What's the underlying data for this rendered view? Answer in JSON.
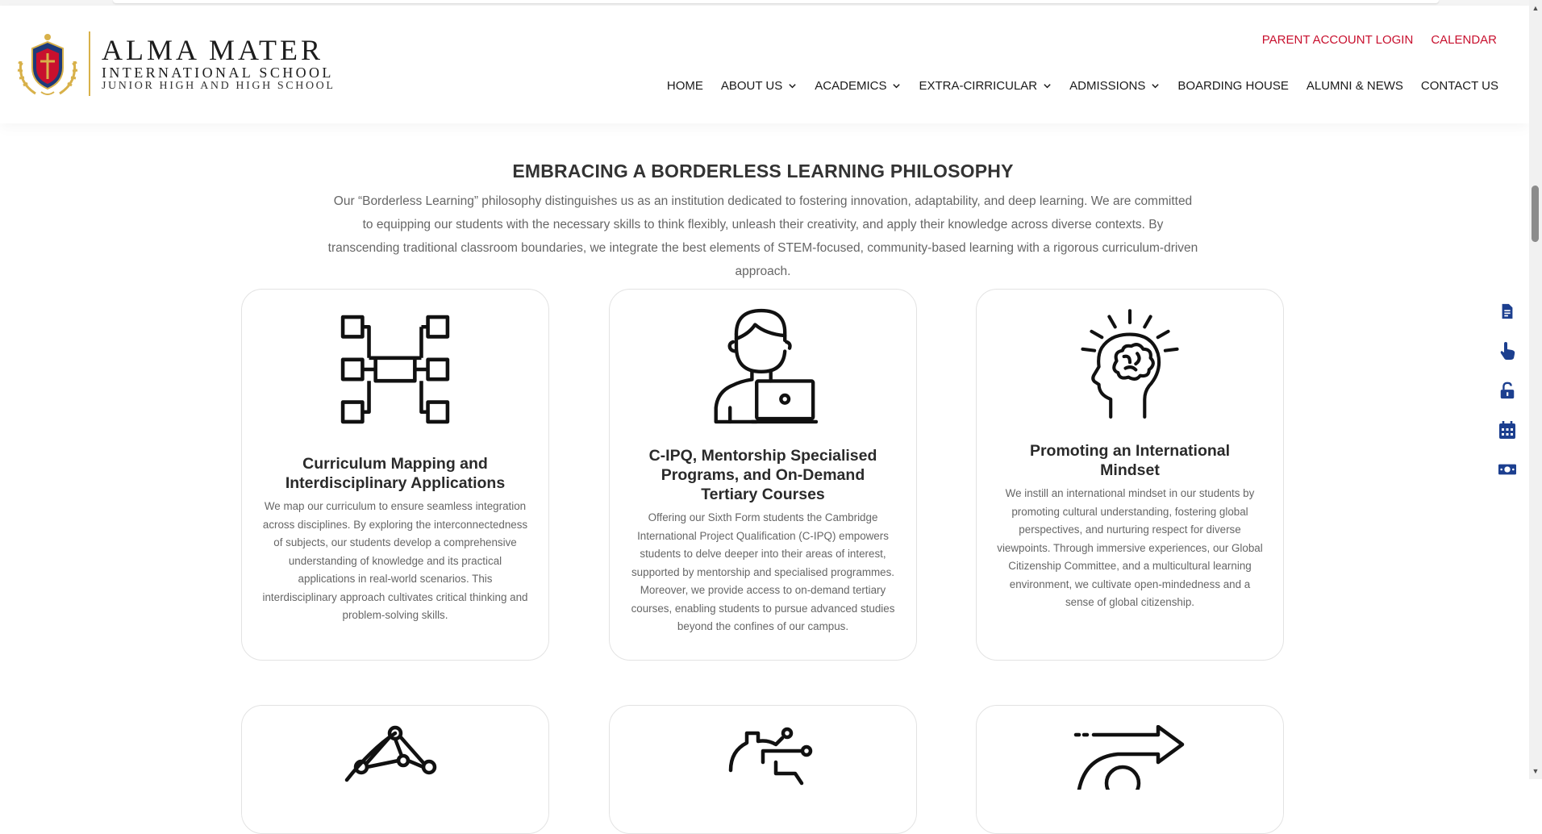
{
  "header": {
    "logo": {
      "line1": "ALMA MATER",
      "line2": "INTERNATIONAL SCHOOL",
      "line3": "JUNIOR HIGH AND HIGH SCHOOL",
      "crest_text": "ALMA MATER"
    },
    "utility_links": [
      "PARENT ACCOUNT LOGIN",
      "CALENDAR"
    ],
    "nav": [
      {
        "label": "HOME",
        "dropdown": false
      },
      {
        "label": "ABOUT US",
        "dropdown": true
      },
      {
        "label": "ACADEMICS",
        "dropdown": true
      },
      {
        "label": "EXTRA-CIRRICULAR",
        "dropdown": true
      },
      {
        "label": "ADMISSIONS",
        "dropdown": true
      },
      {
        "label": "BOARDING HOUSE",
        "dropdown": false
      },
      {
        "label": "ALUMNI & NEWS",
        "dropdown": false
      },
      {
        "label": "CONTACT US",
        "dropdown": false
      }
    ]
  },
  "section": {
    "title": "EMBRACING A BORDERLESS LEARNING PHILOSOPHY",
    "intro": "Our “Borderless Learning” philosophy distinguishes us as an institution dedicated to fostering innovation, adaptability, and deep learning. We are committed to equipping our students with the necessary skills to think flexibly, unleash their creativity, and apply their knowledge across diverse contexts. By transcending traditional classroom boundaries, we integrate the best elements of STEM-focused, community-based learning with a rigorous curriculum-driven approach."
  },
  "cards": [
    {
      "icon": "curriculum-map-icon",
      "title": "Curriculum Mapping and Interdisciplinary Applications",
      "text": "We map our curriculum to ensure seamless integration across disciplines. By exploring the interconnectedness of subjects, our students develop a comprehensive understanding of knowledge and its practical applications in real-world scenarios. This interdisciplinary approach cultivates critical thinking and problem-solving skills."
    },
    {
      "icon": "student-laptop-icon",
      "title": "C-IPQ, Mentorship Specialised Programs, and On-Demand Tertiary Courses",
      "text": "Offering our Sixth Form students the Cambridge International Project Qualification (C-IPQ) empowers students to delve deeper into their areas of interest, supported by mentorship and specialised programmes. Moreover, we provide access to on-demand tertiary courses, enabling students to pursue advanced studies beyond the confines of our campus."
    },
    {
      "icon": "brain-head-icon",
      "title": "Promoting an International Mindset",
      "text": "We instill an international mindset in our students by promoting cultural understanding, fostering global perspectives, and nurturing respect for diverse viewpoints. Through immersive experiences, our Global Citizenship Committee, and a multicultural learning environment, we cultivate open-mindedness and a sense of global citizenship."
    }
  ],
  "next_cards": [
    {
      "icon": "network-nodes-icon"
    },
    {
      "icon": "gear-circuit-icon"
    },
    {
      "icon": "speed-arrow-icon"
    }
  ],
  "dock": [
    {
      "icon": "document-icon"
    },
    {
      "icon": "pointer-hand-icon"
    },
    {
      "icon": "unlock-icon"
    },
    {
      "icon": "calendar-icon"
    },
    {
      "icon": "money-icon"
    }
  ],
  "colors": {
    "accent_red": "#c8102e",
    "dock_blue": "#1c3f8f",
    "gold": "#d8b14a",
    "crest_navy": "#1d3a7a"
  }
}
